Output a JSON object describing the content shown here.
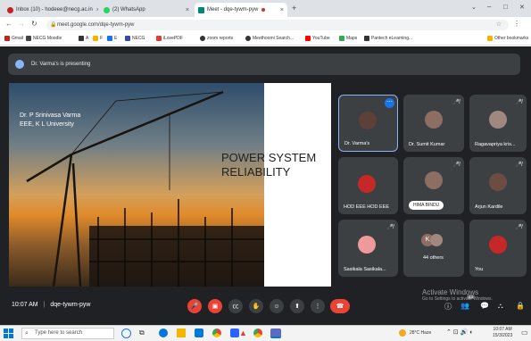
{
  "browser": {
    "tabs": [
      {
        "label": "Inbox (10) - hodeee@necg.ac.in",
        "color": "#c5221f",
        "close": "×"
      },
      {
        "label": "(2) WhatsApp",
        "color": "#25d366",
        "close": "×"
      },
      {
        "label": "Meet - dqe-tywm-pyw",
        "color": "#00897b",
        "close": "×"
      }
    ],
    "new_tab": "+",
    "url": "meet.google.com/dqe-tywm-pyw",
    "window_controls": [
      "⌄",
      "–",
      "□",
      "✕"
    ],
    "bookmarks": [
      {
        "label": "Gmail",
        "color": "#c5221f"
      },
      {
        "label": "NECG Moodle",
        "color": "#444"
      },
      {
        "label": "A",
        "color": "#333"
      },
      {
        "label": "F",
        "color": "#f4b400"
      },
      {
        "label": "E",
        "color": "#1a73e8"
      },
      {
        "label": "NECG",
        "color": "#3949ab"
      },
      {
        "label": "iLovePDF",
        "color": "#e53935"
      },
      {
        "label": "zoom reports",
        "color": "#333"
      },
      {
        "label": "Meethoomi Search...",
        "color": "#333"
      },
      {
        "label": "YouTube",
        "color": "#ff0000"
      },
      {
        "label": "Maps",
        "color": "#34a853"
      },
      {
        "label": "Pantech eLearning...",
        "color": "#333"
      }
    ],
    "other_bookmarks": "Other bookmarks"
  },
  "meet": {
    "presenting_banner": "Dr. Varma's is presenting",
    "slide": {
      "author": "Dr. P Srinivasa Varma",
      "affiliation": "EEE, K L University",
      "title_line1": "POWER SYSTEM",
      "title_line2": "RELIABILITY"
    },
    "participants": [
      {
        "name": "Dr. Varma's",
        "avatar_color": "#5d4037"
      },
      {
        "name": "Dr. Sumit Kumar",
        "avatar_color": "#8d6e63"
      },
      {
        "name": "Ragavapriya kris...",
        "avatar_color": "#a1887f"
      },
      {
        "name": "HOD EEE HOD EEE",
        "avatar_color": "#c62828"
      },
      {
        "name": "HIMA BINDU",
        "avatar_color": "#8d6e63"
      },
      {
        "name": "Arjun Kardile",
        "avatar_color": "#6d4c41"
      },
      {
        "name": "Sasikala Sasikala...",
        "avatar_color": "#ef9a9a"
      },
      {
        "name": "44 others",
        "avatar_letter": "K",
        "avatar_color": "#8d6e63"
      },
      {
        "name": "You",
        "avatar_color": "#c62828"
      }
    ],
    "time": "10:07 AM",
    "separator": "|",
    "meeting_code": "dqe-tywm-pyw",
    "others_count": "44",
    "watermark_line1": "Activate Windows",
    "watermark_line2": "Go to Settings to activate Windows."
  },
  "taskbar": {
    "search_placeholder": "Type here to search",
    "weather": "28°C  Haze",
    "clock_time": "10:07 AM",
    "clock_date": "15/3/2023"
  }
}
